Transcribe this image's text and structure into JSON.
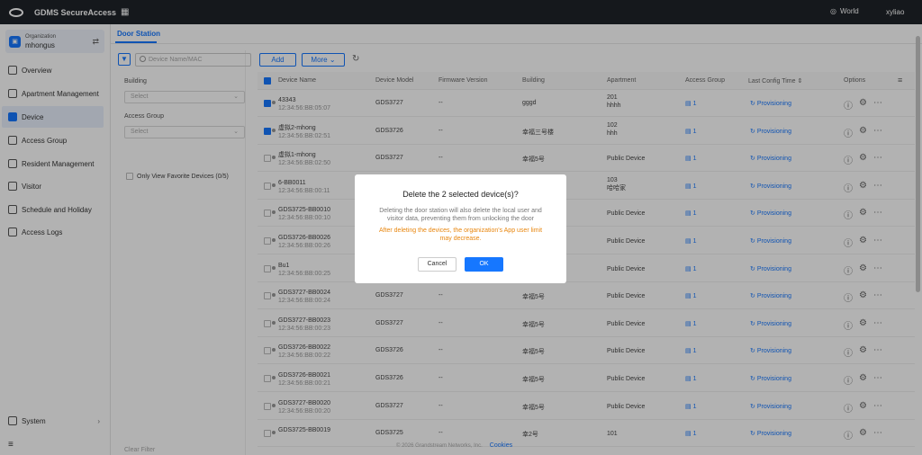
{
  "topbar": {
    "title": "GDMS SecureAccess",
    "region": "World",
    "user": "xyliao"
  },
  "sidebar": {
    "org_label": "Organization",
    "org_name": "mhongus",
    "items": [
      {
        "label": "Overview",
        "icon": "overview-icon"
      },
      {
        "label": "Apartment Management",
        "icon": "apartment-icon"
      },
      {
        "label": "Device",
        "icon": "device-icon"
      },
      {
        "label": "Access Group",
        "icon": "access-group-icon"
      },
      {
        "label": "Resident Management",
        "icon": "resident-icon"
      },
      {
        "label": "Visitor",
        "icon": "visitor-icon"
      },
      {
        "label": "Schedule and Holiday",
        "icon": "calendar-icon"
      },
      {
        "label": "Access Logs",
        "icon": "logs-icon"
      }
    ],
    "system": "System"
  },
  "main": {
    "tab": "Door Station"
  },
  "filter": {
    "search_placeholder": "Device Name/MAC",
    "building_label": "Building",
    "building_value": "Select",
    "access_group_label": "Access Group",
    "access_group_value": "Select",
    "favorite": "Only View Favorite Devices (0/5)",
    "clear": "Clear Filter"
  },
  "toolbar": {
    "add": "Add",
    "more": "More"
  },
  "table": {
    "headers": [
      "Device Name",
      "Device Model",
      "Firmware Version",
      "Building",
      "Apartment",
      "Access Group",
      "Last Config Time",
      "Options"
    ],
    "rows": [
      {
        "name": "43343",
        "mac": "12:34:56:BB:05:07",
        "model": "GDS3727",
        "fw": "--",
        "building": "gggd",
        "apt1": "201",
        "apt2": "hhhh",
        "ag": "1",
        "cfg": "Provisioning",
        "checked": true
      },
      {
        "name": "虚拟2-mhong",
        "mac": "12:34:56:BB:02:51",
        "model": "GDS3726",
        "fw": "--",
        "building": "幸福三号楼",
        "apt1": "102",
        "apt2": "hhh",
        "ag": "1",
        "cfg": "Provisioning",
        "checked": true
      },
      {
        "name": "虚拟1-mhong",
        "mac": "12:34:56:BB:02:50",
        "model": "GDS3727",
        "fw": "--",
        "building": "幸福5号",
        "apt1": "Public Device",
        "apt2": "",
        "ag": "1",
        "cfg": "Provisioning",
        "checked": false
      },
      {
        "name": "6-BB0011",
        "mac": "12:34:56:BB:00:11",
        "model": "",
        "fw": "",
        "building": "",
        "apt1": "103",
        "apt2": "哈哈家",
        "ag": "1",
        "cfg": "Provisioning",
        "checked": false
      },
      {
        "name": "GDS3725-BB0010",
        "mac": "12:34:56:BB:00:10",
        "model": "",
        "fw": "",
        "building": "",
        "apt1": "Public Device",
        "apt2": "",
        "ag": "1",
        "cfg": "Provisioning",
        "checked": false
      },
      {
        "name": "GDS3726-BB0026",
        "mac": "12:34:56:BB:00:26",
        "model": "",
        "fw": "",
        "building": "",
        "apt1": "Public Device",
        "apt2": "",
        "ag": "1",
        "cfg": "Provisioning",
        "checked": false
      },
      {
        "name": "Bu1",
        "mac": "12:34:56:BB:00:25",
        "model": "",
        "fw": "",
        "building": "",
        "apt1": "Public Device",
        "apt2": "",
        "ag": "1",
        "cfg": "Provisioning",
        "checked": false
      },
      {
        "name": "GDS3727-BB0024",
        "mac": "12:34:56:BB:00:24",
        "model": "GDS3727",
        "fw": "--",
        "building": "幸福5号",
        "apt1": "Public Device",
        "apt2": "",
        "ag": "1",
        "cfg": "Provisioning",
        "checked": false
      },
      {
        "name": "GDS3727-BB0023",
        "mac": "12:34:56:BB:00:23",
        "model": "GDS3727",
        "fw": "--",
        "building": "幸福5号",
        "apt1": "Public Device",
        "apt2": "",
        "ag": "1",
        "cfg": "Provisioning",
        "checked": false
      },
      {
        "name": "GDS3726-BB0022",
        "mac": "12:34:56:BB:00:22",
        "model": "GDS3726",
        "fw": "--",
        "building": "幸福5号",
        "apt1": "Public Device",
        "apt2": "",
        "ag": "1",
        "cfg": "Provisioning",
        "checked": false
      },
      {
        "name": "GDS3726-BB0021",
        "mac": "12:34:56:BB:00:21",
        "model": "GDS3726",
        "fw": "--",
        "building": "幸福5号",
        "apt1": "Public Device",
        "apt2": "",
        "ag": "1",
        "cfg": "Provisioning",
        "checked": false
      },
      {
        "name": "GDS3727-BB0020",
        "mac": "12:34:56:BB:00:20",
        "model": "GDS3727",
        "fw": "--",
        "building": "幸福5号",
        "apt1": "Public Device",
        "apt2": "",
        "ag": "1",
        "cfg": "Provisioning",
        "checked": false
      },
      {
        "name": "GDS3725-BB0019",
        "mac": "",
        "model": "GDS3725",
        "fw": "--",
        "building": "幸2号",
        "apt1": "101",
        "apt2": "",
        "ag": "1",
        "cfg": "Provisioning",
        "checked": false
      }
    ]
  },
  "modal": {
    "title": "Delete the 2 selected device(s)?",
    "body": "Deleting the door station will also delete the local user and visitor data, preventing them from unlocking the door",
    "warning": "After deleting the devices, the organization's App user limit may decrease.",
    "cancel": "Cancel",
    "ok": "OK"
  },
  "footer": {
    "copyright": "© 2026 Grandstream Networks, Inc.",
    "cookies": "Cookies"
  },
  "colors": {
    "accent": "#1677ff",
    "warning": "#e8860e",
    "topbar": "#1f2329"
  }
}
